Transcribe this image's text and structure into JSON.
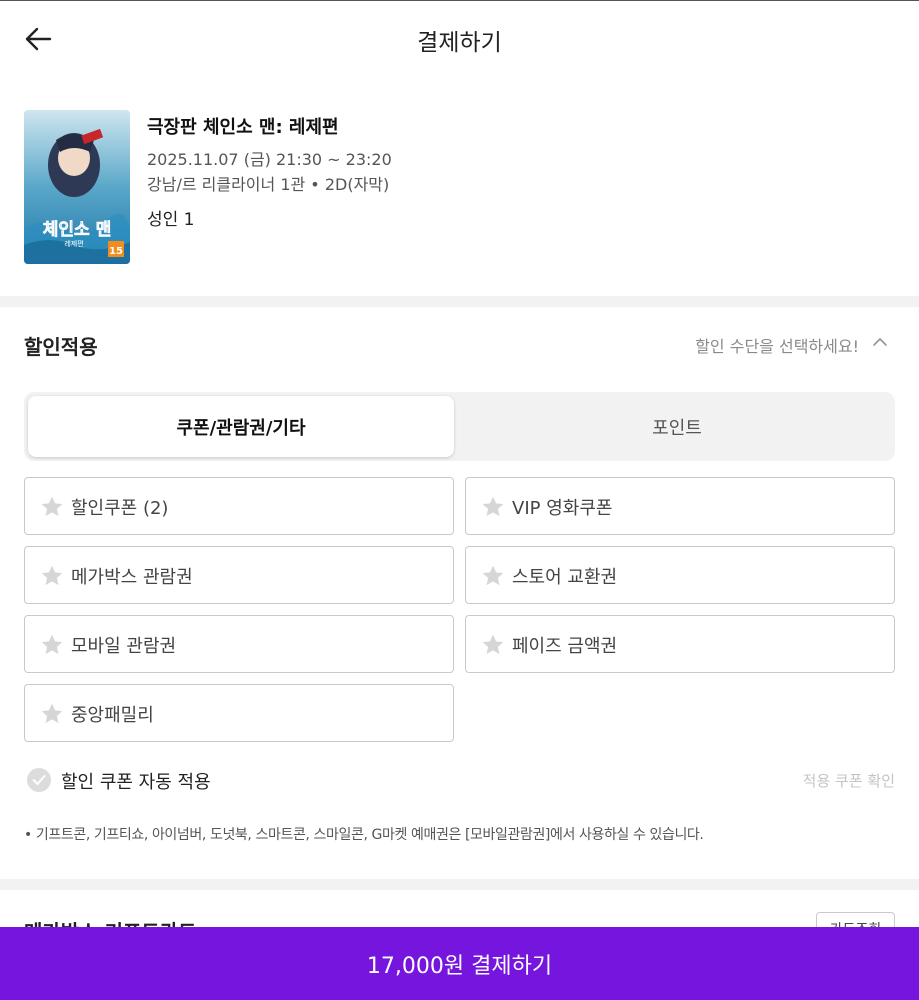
{
  "header": {
    "title": "결제하기",
    "back_icon": "arrow-left-icon"
  },
  "movie": {
    "title": "극장판 체인소 맨: 레제편",
    "datetime": "2025.11.07 (금) 21:30 ~ 23:20",
    "venue": "강남/르 리클라이너 1관 • 2D(자막)",
    "people": "성인 1",
    "poster": {
      "title_text": "체인소 맨",
      "subtitle_text": "레제편",
      "rating": "15"
    }
  },
  "discount": {
    "title": "할인적용",
    "hint": "할인 수단을 선택하세요!",
    "toggle_icon": "chevron-up-icon",
    "tabs": [
      {
        "label": "쿠폰/관람권/기타",
        "active": true
      },
      {
        "label": "포인트",
        "active": false
      }
    ],
    "options": [
      {
        "label": "할인쿠폰 (2)",
        "icon": "star-icon"
      },
      {
        "label": "VIP 영화쿠폰",
        "icon": "star-icon"
      },
      {
        "label": "메가박스 관람권",
        "icon": "star-icon"
      },
      {
        "label": "스토어 교환권",
        "icon": "star-icon"
      },
      {
        "label": "모바일 관람권",
        "icon": "star-icon"
      },
      {
        "label": "페이즈 금액권",
        "icon": "star-icon"
      },
      {
        "label": "중앙패밀리",
        "icon": "star-icon"
      }
    ],
    "auto_apply": {
      "label": "할인 쿠폰 자동 적용",
      "checked": true
    },
    "confirm_link": "적용 쿠폰 확인",
    "notice": "• 기프트콘, 기프티쇼, 아이넘버, 도넛북, 스마트콘, 스마일콘, G마켓 예매권은 [모바일관람권]에서 사용하실 수 있습니다."
  },
  "giftcard": {
    "title": "메가박스 기프트카드",
    "button": "카드조회"
  },
  "pay": {
    "label": "17,000원 결제하기"
  },
  "colors": {
    "accent": "#7515dd",
    "band": "#f2f2f2",
    "border": "#c9c9c9",
    "muted": "#8a8a8a"
  }
}
